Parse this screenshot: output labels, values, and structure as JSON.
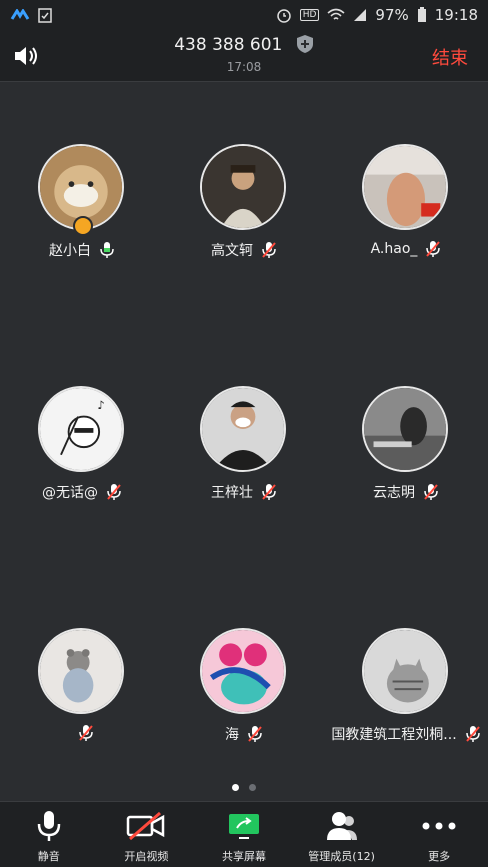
{
  "status_bar": {
    "battery": "97%",
    "time": "19:18",
    "hd_badge": "HD"
  },
  "header": {
    "meeting_id": "438 388 601",
    "timer": "17:08",
    "end_label": "结束"
  },
  "participants": [
    {
      "name": "赵小白",
      "mic": "on",
      "host": true
    },
    {
      "name": "高文轲",
      "mic": "muted"
    },
    {
      "name": "A.hao_",
      "mic": "muted"
    },
    {
      "name": "@无话@",
      "mic": "muted"
    },
    {
      "name": "王梓壮",
      "mic": "muted"
    },
    {
      "name": "云志明",
      "mic": "muted"
    },
    {
      "name": "",
      "mic": "muted"
    },
    {
      "name": "海",
      "mic": "muted"
    },
    {
      "name": "国教建筑工程刘桐...",
      "mic": "muted"
    }
  ],
  "pagination": {
    "pages": 2,
    "current": 1
  },
  "toolbar": {
    "mute_label": "静音",
    "video_label": "开启视频",
    "share_label": "共享屏幕",
    "manage_label": "管理成员(12)",
    "more_label": "更多"
  },
  "colors": {
    "accent_red": "#ff4a3d",
    "mic_on": "#4cd964",
    "share_green": "#22c55e",
    "background": "#2b2d30"
  }
}
